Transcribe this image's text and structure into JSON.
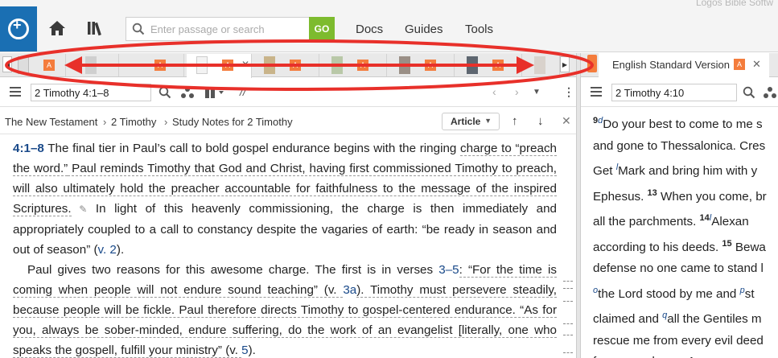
{
  "app": {
    "title": "Logos Bible Softw"
  },
  "topbar": {
    "search_placeholder": "Enter passage or search",
    "go_label": "GO",
    "menu": [
      "Docs",
      "Guides",
      "Tools"
    ]
  },
  "tabs": {
    "badge": "A",
    "count": 9,
    "active_index": 2
  },
  "right_tab": {
    "label": "English Standard Version",
    "badge": "A"
  },
  "left_pane": {
    "reference": "2 Timothy 4:1–8",
    "breadcrumb": [
      "The New Testament",
      "2 Timothy",
      "Study Notes for 2 Timothy"
    ],
    "view_mode": "Article"
  },
  "right_pane": {
    "reference": "2 Timothy 4:10"
  },
  "article": {
    "ref_heading": "4:1–8",
    "p1_a": " The final tier in Paul’s call to bold gospel endurance begins with the ringing ",
    "p1_b": "charge to “preach the word.”",
    "p1_c": " Paul reminds Timothy that God and Christ, having first commissioned Timothy to preach, will also ultimately hold the preacher accountable for faithfulness to the message of the inspired Scriptures.",
    "p1_d": " In light of this heavenly commissioning, the charge is then immediately and appropriately coupled to a call to constancy despite the vagaries of earth: “be ready in season and out of season” (",
    "p1_ref": "v. 2",
    "p1_e": ").",
    "p2_a": "Paul gives two reasons for this awesome charge. The first is in verses ",
    "p2_ref1": "3–5",
    "p2_b": ": “For the time is coming when people will not endure sound teaching” (v. ",
    "p2_ref2": "3a",
    "p2_c": "). Timothy must persevere steadily, because people will be fickle. Paul therefore directs Timothy to gospel-centered endurance. “As for you, always be sober-minded, endure suffering, do the work of an evangelist [literally, one who speaks the gospell, fulfill your ministry” (v. ",
    "p2_ref3": "5",
    "p2_d": ")."
  },
  "esv_lines": [
    {
      "vn": "9",
      "fn": "d",
      "text": "Do your best to come to me s"
    },
    {
      "text": "and gone to Thessalonica. Cres"
    },
    {
      "pre": "Get ",
      "fn": "l",
      "text": "Mark and bring him with y"
    },
    {
      "pre": "Ephesus. ",
      "vn": "13",
      "text": " When you come, br"
    },
    {
      "pre": "all  the  parchments. ",
      "vn": "14",
      "fn": "l",
      "text": "Alexan"
    },
    {
      "pre": "according to his deeds. ",
      "vn": "15",
      "text": " Bewa"
    },
    {
      "text": "defense no one came to stand l"
    },
    {
      "fn": "o",
      "text": "the  Lord  stood  by  me  and ",
      "fn2": "p",
      "text2": "st"
    },
    {
      "pre": "claimed and ",
      "fn": "q",
      "text": "all the Gentiles m"
    },
    {
      "text": "rescue me from every evil deed"
    },
    {
      "text": "forever and ever. Amen."
    }
  ],
  "colors": {
    "logo_blue": "#1a6fb3",
    "go_green": "#7dbb2e",
    "badge_orange": "#f47c3c",
    "annotation_red": "#e8302a",
    "link_blue": "#1a4a8a"
  }
}
